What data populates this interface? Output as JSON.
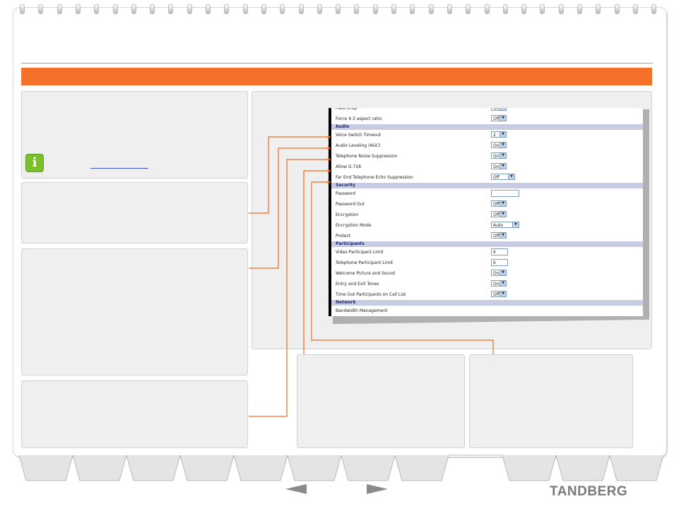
{
  "brand": {
    "name": "TANDBERG"
  },
  "screenshot": {
    "rows": [
      {
        "type": "row",
        "label": "Field Drop",
        "control": "select",
        "value": "Off",
        "w": 22
      },
      {
        "type": "row",
        "label": "Force 4:3 aspect ratio",
        "control": "select",
        "value": "Off",
        "w": 22
      },
      {
        "type": "header",
        "label": "Audio"
      },
      {
        "type": "row",
        "label": "Voice Switch Timeout",
        "control": "select",
        "value": "2",
        "w": 22
      },
      {
        "type": "row",
        "label": "Audio Leveling (AGC)",
        "control": "select",
        "value": "On",
        "w": 22
      },
      {
        "type": "row",
        "label": "Telephone Noise Suppression",
        "control": "select",
        "value": "On",
        "w": 22
      },
      {
        "type": "row",
        "label": "Allow G.728",
        "control": "select",
        "value": "On",
        "w": 22
      },
      {
        "type": "row",
        "label": "Far End Telephone Echo Suppression",
        "control": "select",
        "value": "Off",
        "w": 34
      },
      {
        "type": "header",
        "label": "Security"
      },
      {
        "type": "row",
        "label": "Password",
        "control": "input",
        "value": "",
        "w": 40
      },
      {
        "type": "row",
        "label": "Password Out",
        "control": "select",
        "value": "Off",
        "w": 22
      },
      {
        "type": "row",
        "label": "Encryption",
        "control": "select",
        "value": "Off",
        "w": 22
      },
      {
        "type": "row",
        "label": "Encryption Mode",
        "control": "select",
        "value": "Auto",
        "w": 40
      },
      {
        "type": "row",
        "label": "Protect",
        "control": "select",
        "value": "Off",
        "w": 22
      },
      {
        "type": "header",
        "label": "Participants"
      },
      {
        "type": "row",
        "label": "Video Participant Limit",
        "control": "input",
        "value": "6",
        "w": 24
      },
      {
        "type": "row",
        "label": "Telephone Participant Limit",
        "control": "input",
        "value": "6",
        "w": 24
      },
      {
        "type": "row",
        "label": "Welcome Picture and Sound",
        "control": "select",
        "value": "On",
        "w": 22
      },
      {
        "type": "row",
        "label": "Entry and Exit Tones",
        "control": "select",
        "value": "On",
        "w": 22
      },
      {
        "type": "row",
        "label": "Time Out Participants on Call List",
        "control": "select",
        "value": "Off",
        "w": 22
      },
      {
        "type": "header",
        "label": "Network"
      },
      {
        "type": "row",
        "label": "Bandwidth Management",
        "control": "none",
        "value": ""
      }
    ]
  },
  "colors": {
    "accent": "#f5712a",
    "connector": "#f26a21",
    "panel": "#efefef",
    "section_header": "#c7cbe4"
  },
  "icons": {
    "info": "info-icon",
    "prev": "left-arrow-icon",
    "next": "right-arrow-icon"
  },
  "nav": {
    "active_tab_index": 8
  }
}
